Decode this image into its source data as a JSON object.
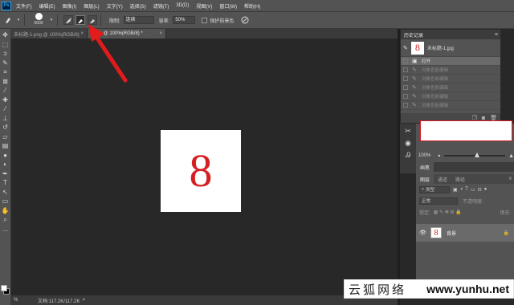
{
  "app": {
    "logo": "Ps",
    "menu": [
      "文件(F)",
      "编辑(E)",
      "图像(I)",
      "图层(L)",
      "文字(Y)",
      "选择(S)",
      "滤镜(T)",
      "3D(D)",
      "视图(V)",
      "窗口(W)",
      "帮助(H)"
    ]
  },
  "options_bar": {
    "brush_size": "5000",
    "limit_label": "限制:",
    "limit_value": "连续",
    "tolerance_label": "容差:",
    "tolerance_value": "50%",
    "protect_fg_label": "保护前景色",
    "icons": [
      "tool-preset-icon",
      "brush-icon",
      "sampling-continuous-icon",
      "sampling-once-icon",
      "sampling-bg-swatch-icon",
      "pressure-icon"
    ]
  },
  "tabs": [
    {
      "label": "未标题-1.png @ 100%(RGB/8)",
      "active": false,
      "close": "×"
    },
    {
      "label": "-1.jpg @ 100%(RGB/8) *",
      "active": true,
      "close": "×"
    }
  ],
  "document": {
    "content": "8",
    "text_color": "#d42023"
  },
  "status": {
    "zoom": "%",
    "doc_info": "文档:117.2K/117.2K",
    "arrow": ">"
  },
  "history_panel": {
    "title": "历史记录",
    "menu_icon": "≡",
    "snapshot_label": "未标题-1.jpg",
    "snapshot_thumb": "8",
    "items": [
      {
        "label": "打开",
        "current": true
      },
      {
        "label": "对象色彩编辑",
        "current": false
      },
      {
        "label": "对象色彩编辑",
        "current": false
      },
      {
        "label": "对象色彩编辑",
        "current": false
      },
      {
        "label": "对象色彩编辑",
        "current": false
      },
      {
        "label": "对象色彩编辑",
        "current": false
      }
    ],
    "footer_icons": [
      "new-doc-from-state-icon",
      "camera-icon",
      "trash-icon"
    ]
  },
  "navigator": {
    "zoom_label": "100%"
  },
  "layers_panel": {
    "top_tab": "画笔",
    "tabs": [
      "图层",
      "通道",
      "路径"
    ],
    "kind_label": "类型",
    "blend_mode": "正常",
    "opacity_label": "不透明度:",
    "lock_label": "锁定:",
    "fill_label": "填充:",
    "layer_name": "背景",
    "layer_thumb": "8"
  },
  "watermark": {
    "cn": "云狐网络",
    "url": "www.yunhu.net"
  },
  "colors": {
    "accent_red": "#d42023",
    "panel_bg": "#535353",
    "canvas_bg": "#282828"
  }
}
